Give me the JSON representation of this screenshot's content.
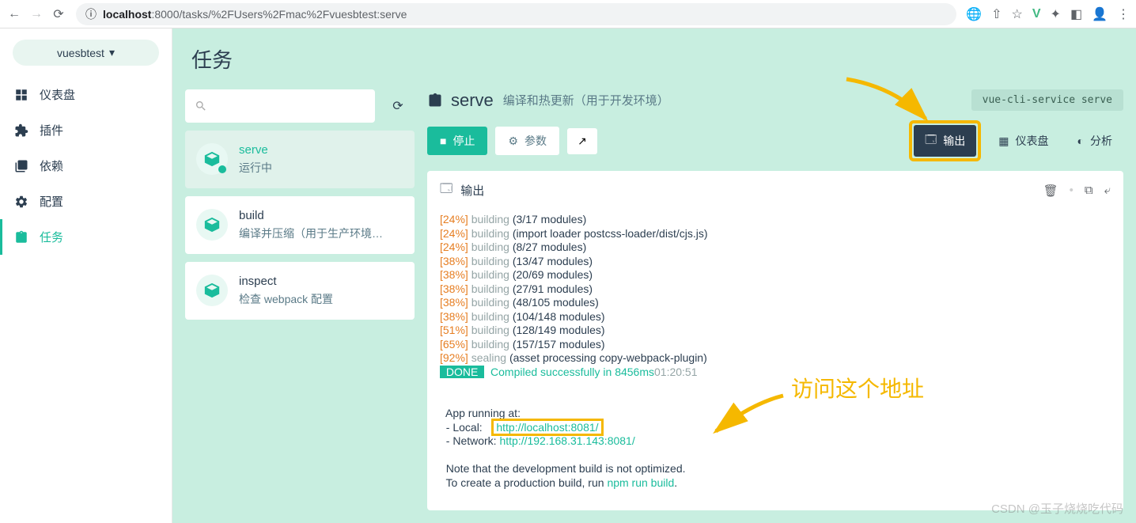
{
  "browser": {
    "url_host": "localhost",
    "url_port_path": ":8000/tasks/%2FUsers%2Fmac%2Fvuesbtest:serve"
  },
  "project": {
    "name": "vuesbtest"
  },
  "nav": [
    {
      "label": "仪表盘"
    },
    {
      "label": "插件"
    },
    {
      "label": "依赖"
    },
    {
      "label": "配置"
    },
    {
      "label": "任务"
    }
  ],
  "page_title": "任务",
  "tasks": [
    {
      "name": "serve",
      "desc": "运行中"
    },
    {
      "name": "build",
      "desc": "编译并压缩（用于生产环境…"
    },
    {
      "name": "inspect",
      "desc": "检查 webpack 配置"
    }
  ],
  "detail": {
    "name": "serve",
    "subtitle": "编译和热更新（用于开发环境）",
    "command": "vue-cli-service serve",
    "stop": "停止",
    "params": "参数",
    "tabs": {
      "output": "输出",
      "dashboard": "仪表盘",
      "analyze": "分析"
    }
  },
  "output": {
    "title": "输出",
    "lines": [
      {
        "pct": "[24%]",
        "stage": "building",
        "rest": "(3/17 modules)"
      },
      {
        "pct": "[24%]",
        "stage": "building",
        "rest": "(import loader postcss-loader/dist/cjs.js)"
      },
      {
        "pct": "[24%]",
        "stage": "building",
        "rest": "(8/27 modules)"
      },
      {
        "pct": "[38%]",
        "stage": "building",
        "rest": "(13/47 modules)"
      },
      {
        "pct": "[38%]",
        "stage": "building",
        "rest": "(20/69 modules)"
      },
      {
        "pct": "[38%]",
        "stage": "building",
        "rest": "(27/91 modules)"
      },
      {
        "pct": "[38%]",
        "stage": "building",
        "rest": "(48/105 modules)"
      },
      {
        "pct": "[38%]",
        "stage": "building",
        "rest": "(104/148 modules)"
      },
      {
        "pct": "[51%]",
        "stage": "building",
        "rest": "(128/149 modules)"
      },
      {
        "pct": "[65%]",
        "stage": "building",
        "rest": "(157/157 modules)"
      },
      {
        "pct": "[92%]",
        "stage": "sealing",
        "rest": "(asset processing copy-webpack-plugin)"
      }
    ],
    "done_label": "DONE",
    "done_msg": "Compiled successfully in 8456ms",
    "done_time": "01:20:51",
    "app_running": "  App running at:",
    "local_label": "  - Local:   ",
    "local_url": "http://localhost:8081/",
    "network_label": "  - Network: ",
    "network_url": "http://192.168.31.143:8081/",
    "note1": "  Note that the development build is not optimized.",
    "note2a": "  To create a production build, run ",
    "note2b": "npm run build",
    "note2c": "."
  },
  "annotation": "访问这个地址",
  "watermark": "CSDN @玉子烧烧吃代码"
}
